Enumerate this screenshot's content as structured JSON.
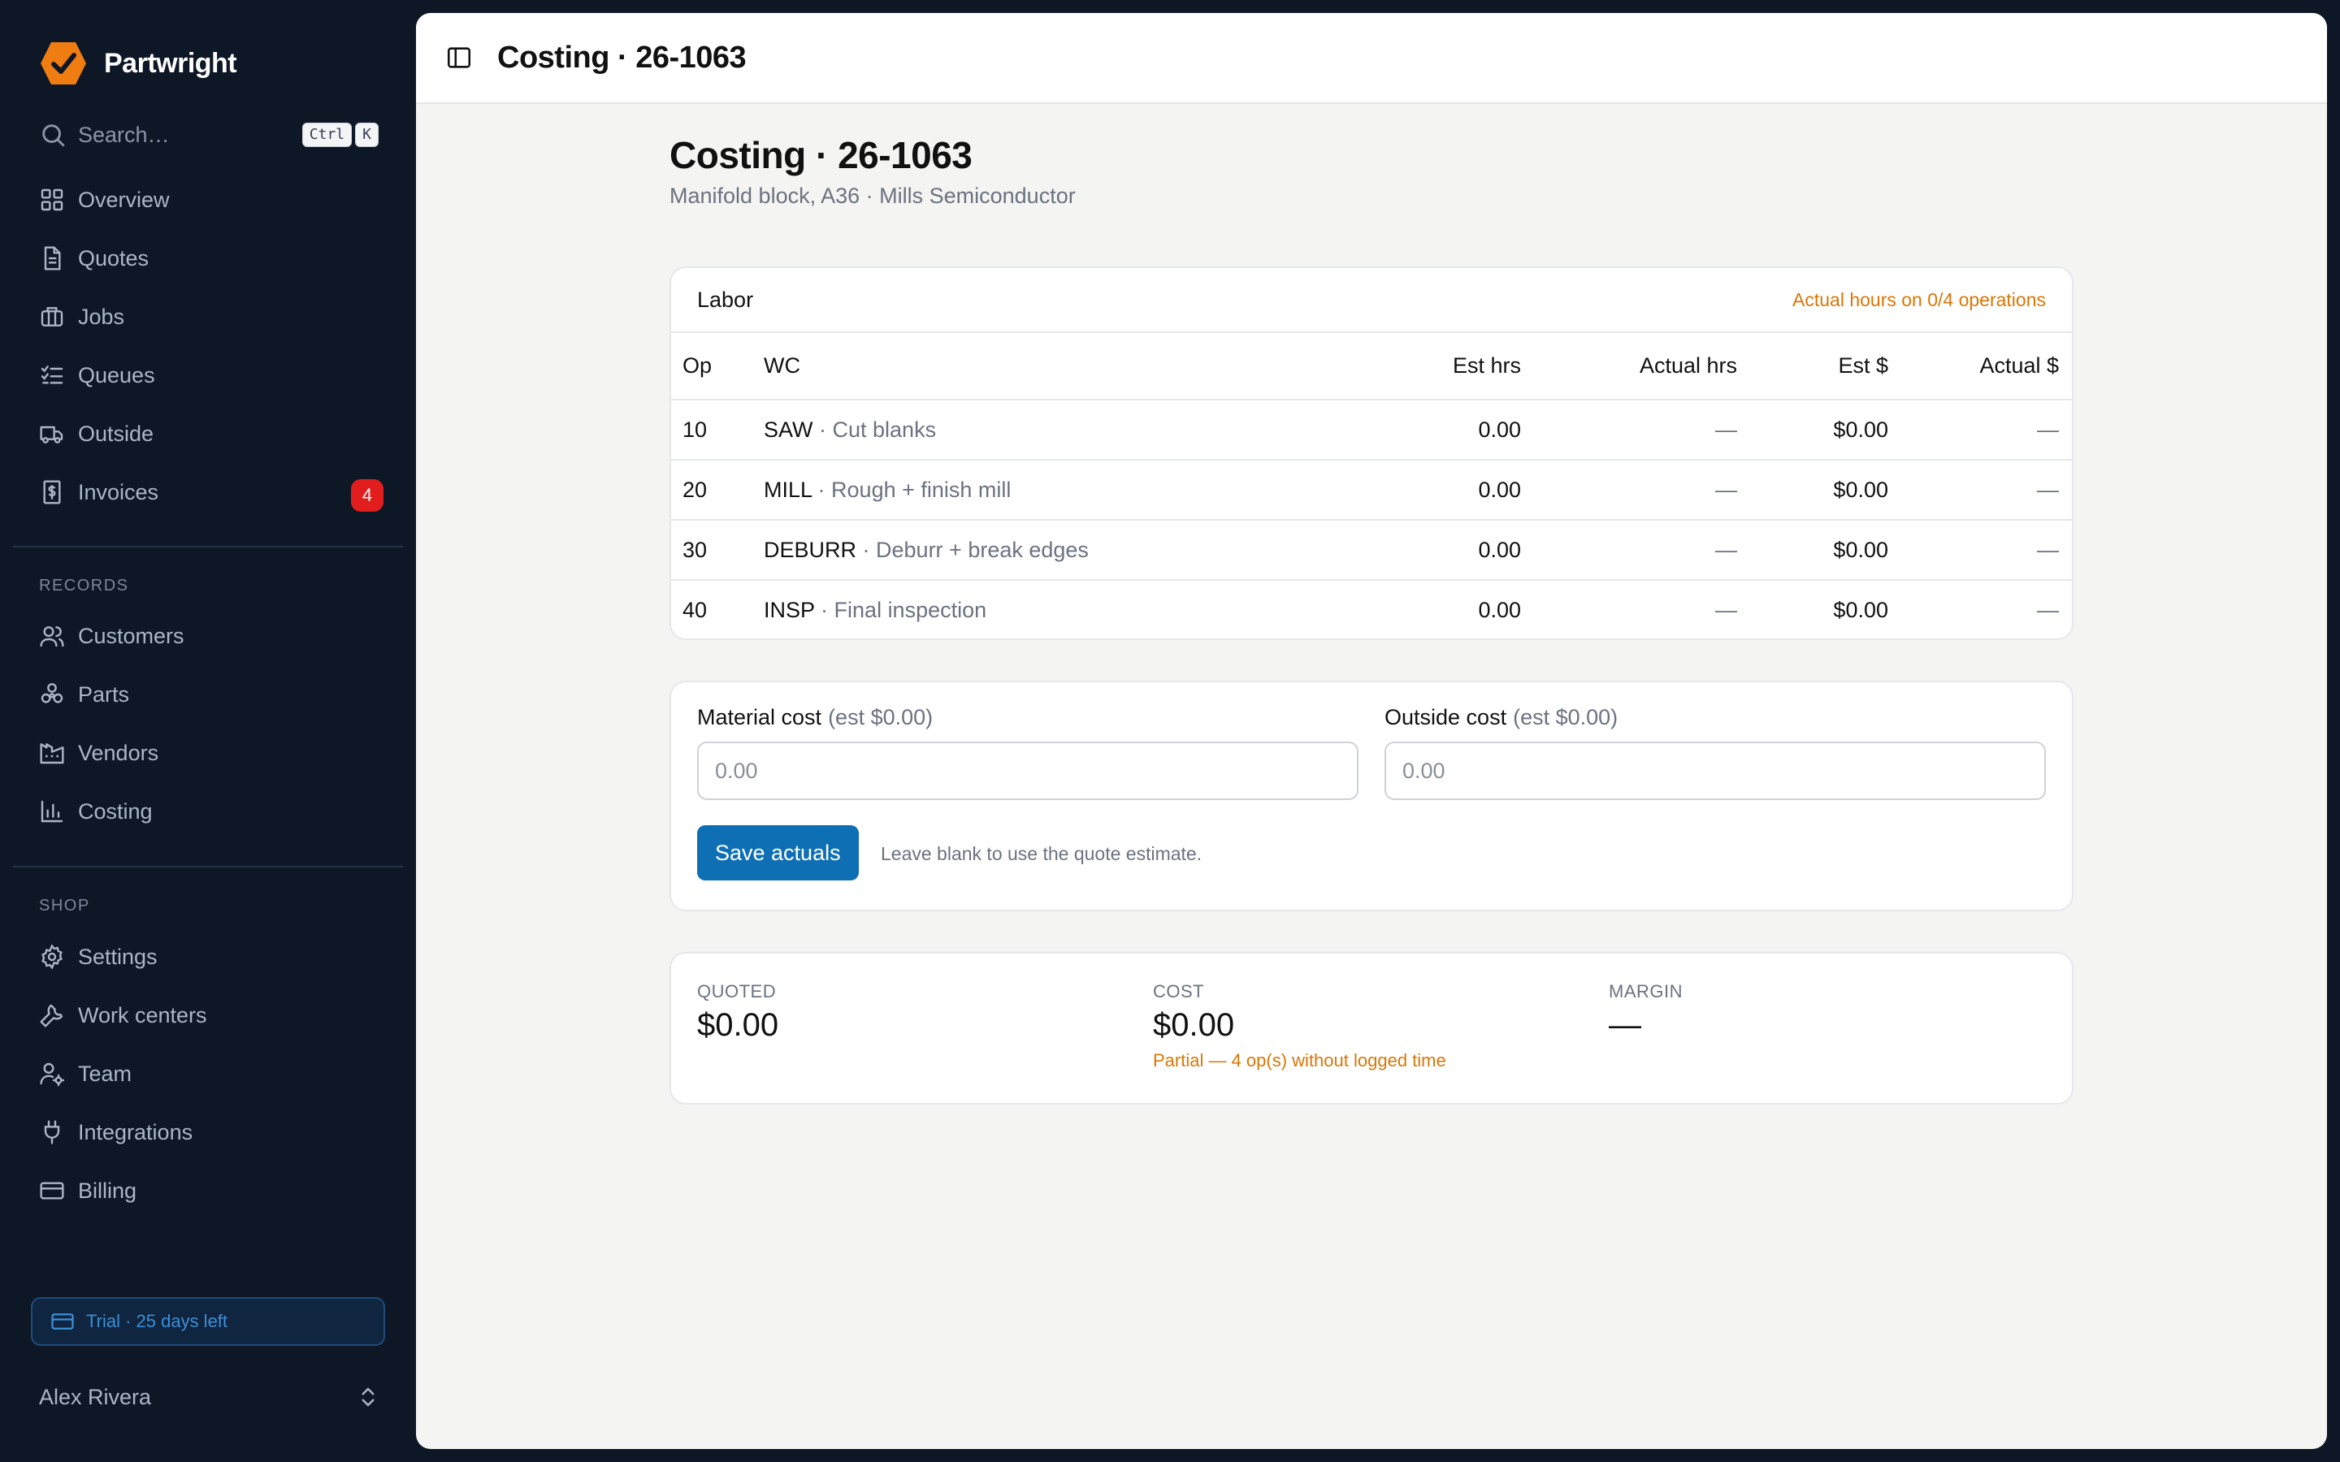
{
  "app": {
    "name": "Partwright"
  },
  "search": {
    "placeholder": "Search…",
    "kbd_ctrl": "Ctrl",
    "kbd_k": "K"
  },
  "nav_main": [
    {
      "label": "Overview",
      "icon": "grid-icon"
    },
    {
      "label": "Quotes",
      "icon": "document-icon"
    },
    {
      "label": "Jobs",
      "icon": "briefcase-icon"
    },
    {
      "label": "Queues",
      "icon": "checklist-icon"
    },
    {
      "label": "Outside",
      "icon": "truck-icon"
    },
    {
      "label": "Invoices",
      "icon": "invoice-dollar-icon",
      "badge": "4"
    }
  ],
  "sections": {
    "records": "RECORDS",
    "shop": "SHOP"
  },
  "nav_records": [
    {
      "label": "Customers",
      "icon": "users-icon"
    },
    {
      "label": "Parts",
      "icon": "parts-icon"
    },
    {
      "label": "Vendors",
      "icon": "factory-icon"
    },
    {
      "label": "Costing",
      "icon": "bar-chart-icon"
    }
  ],
  "nav_shop": [
    {
      "label": "Settings",
      "icon": "gear-icon"
    },
    {
      "label": "Work centers",
      "icon": "wrench-icon"
    },
    {
      "label": "Team",
      "icon": "user-gear-icon"
    },
    {
      "label": "Integrations",
      "icon": "plug-icon"
    },
    {
      "label": "Billing",
      "icon": "credit-card-icon"
    }
  ],
  "trial": {
    "label": "Trial · 25 days left"
  },
  "user": {
    "name": "Alex Rivera"
  },
  "topbar": {
    "title": "Costing · 26-1063"
  },
  "page": {
    "title": "Costing · 26-1063",
    "subtitle": "Manifold block, A36 · Mills Semiconductor"
  },
  "labor": {
    "title": "Labor",
    "status": "Actual hours on 0/4 operations",
    "columns": {
      "op": "Op",
      "wc": "WC",
      "est_hrs": "Est hrs",
      "actual_hrs": "Actual hrs",
      "est_cost": "Est $",
      "actual_cost": "Actual $"
    },
    "rows": [
      {
        "op": "10",
        "wc": "SAW",
        "desc": "· Cut blanks",
        "est_hrs": "0.00",
        "actual_hrs": "—",
        "est_cost": "$0.00",
        "actual_cost": "—"
      },
      {
        "op": "20",
        "wc": "MILL",
        "desc": "· Rough + finish mill",
        "est_hrs": "0.00",
        "actual_hrs": "—",
        "est_cost": "$0.00",
        "actual_cost": "—"
      },
      {
        "op": "30",
        "wc": "DEBURR",
        "desc": "· Deburr + break edges",
        "est_hrs": "0.00",
        "actual_hrs": "—",
        "est_cost": "$0.00",
        "actual_cost": "—"
      },
      {
        "op": "40",
        "wc": "INSP",
        "desc": "· Final inspection",
        "est_hrs": "0.00",
        "actual_hrs": "—",
        "est_cost": "$0.00",
        "actual_cost": "—"
      }
    ]
  },
  "costs": {
    "material": {
      "label": "Material cost",
      "est": "(est $0.00)",
      "placeholder": "0.00"
    },
    "outside": {
      "label": "Outside cost",
      "est": "(est $0.00)",
      "placeholder": "0.00"
    },
    "save_label": "Save actuals",
    "hint": "Leave blank to use the quote estimate."
  },
  "summary": {
    "quoted": {
      "label": "QUOTED",
      "value": "$0.00"
    },
    "cost": {
      "label": "COST",
      "value": "$0.00",
      "note": "Partial — 4 op(s) without logged time"
    },
    "margin": {
      "label": "MARGIN",
      "value": "—"
    }
  },
  "colors": {
    "accent": "#0e6fb5",
    "brand": "#f07d12",
    "warning": "#d97706",
    "sidebar_bg": "#0e1726",
    "badge": "#e11d1d"
  }
}
